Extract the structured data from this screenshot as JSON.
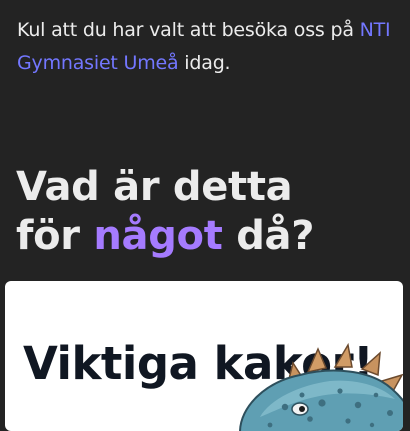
{
  "intro": {
    "before_link": "Kul att du har valt att besöka oss på ",
    "link_text": "NTI Gymnasiet Umeå",
    "after_link": " idag."
  },
  "heading": {
    "line1": "Vad är detta",
    "line2_prefix": "för ",
    "line2_accent": "något",
    "line2_suffix": " då?"
  },
  "card": {
    "title": "Viktiga kakor!",
    "illustration": "cookie-monster-icon"
  },
  "colors": {
    "background": "#232323",
    "link": "#7377ff",
    "accent": "#a57bff",
    "card_background": "#ffffff",
    "card_title": "#101722"
  }
}
